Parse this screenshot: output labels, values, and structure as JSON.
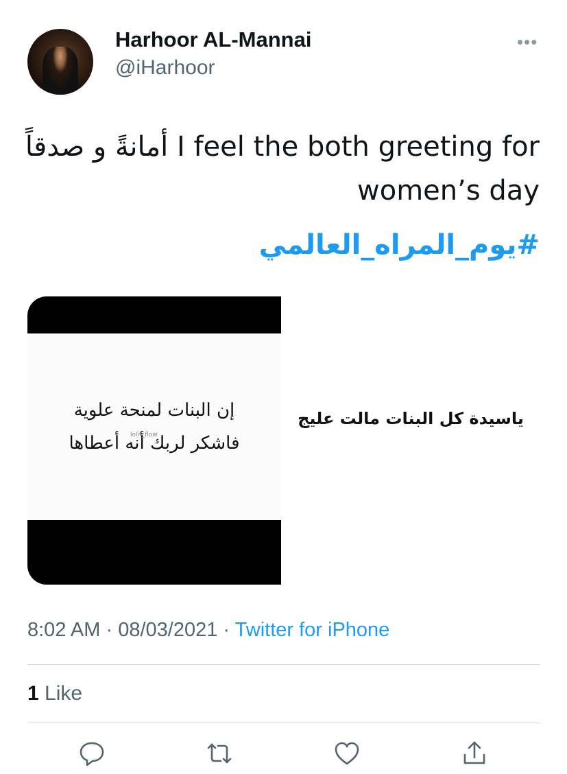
{
  "author": {
    "name": "Harhoor AL-Mannai",
    "handle": "@iHarhoor"
  },
  "more_menu": "•••",
  "tweet": {
    "line1": "أمانةً و صدقاً I feel the both greeting for",
    "line2": "women’s day",
    "hashtag": "#يوم_المراه_العالمي"
  },
  "media": {
    "poem_line1": "إن البنات لمنحة علوية",
    "poem_line2": "فاشكر لربك أنه أعطاها",
    "watermark": "lolit_flow",
    "right_text": "ياسيدة كل البنات مالت عليج"
  },
  "meta": {
    "time": "8:02 AM",
    "date": "08/03/2021",
    "source": "Twitter for iPhone",
    "sep": "·"
  },
  "engagement": {
    "like_count": "1",
    "like_label": "Like"
  },
  "actions": [
    "reply-icon",
    "retweet-icon",
    "like-icon",
    "share-icon"
  ],
  "colors": {
    "link": "#1d9bf0",
    "secondary": "#536471",
    "primary": "#0f1419",
    "divider": "#cfd9de"
  }
}
